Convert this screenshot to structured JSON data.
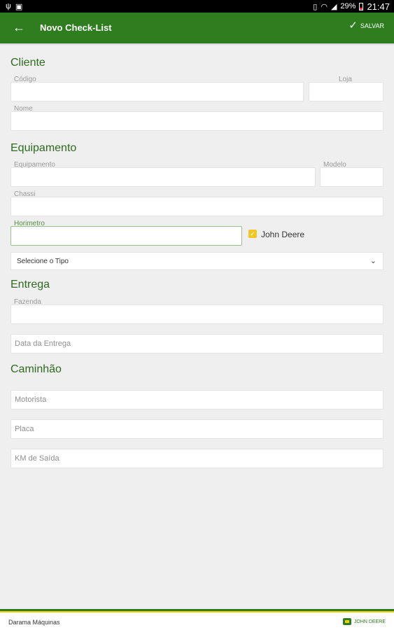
{
  "status_bar": {
    "battery": "29%",
    "time": "21:47",
    "icons": [
      "usb-icon",
      "screenshot-icon",
      "vibrate-icon",
      "wifi-icon",
      "signal-icon",
      "battery-icon"
    ]
  },
  "appbar": {
    "title": "Novo Check-List",
    "save_label": "SALVAR",
    "back_icon": "arrow-left-icon",
    "save_icon": "check-icon",
    "color": "#2e7d1e"
  },
  "form": {
    "cliente": {
      "heading": "Cliente",
      "codigo_label": "Código",
      "loja_label": "Loja",
      "nome_label": "Nome"
    },
    "equipamento": {
      "heading": "Equipamento",
      "equipamento_label": "Equipamento",
      "modelo_label": "Modelo",
      "chassi_label": "Chassi",
      "horimetro_label": "Horimetro",
      "john_deere_label": "John Deere",
      "john_deere_checked": true,
      "tipo_select": "Selecione o Tipo"
    },
    "entrega": {
      "heading": "Entrega",
      "fazenda_label": "Fazenda",
      "data_placeholder": "Data da Entrega"
    },
    "caminhao": {
      "heading": "Caminhão",
      "motorista_placeholder": "Motorista",
      "placa_placeholder": "Placa",
      "km_placeholder": "KM de Saída"
    }
  },
  "footer": {
    "company": "Darama Máquinas",
    "brand": "JOHN DEERE"
  }
}
